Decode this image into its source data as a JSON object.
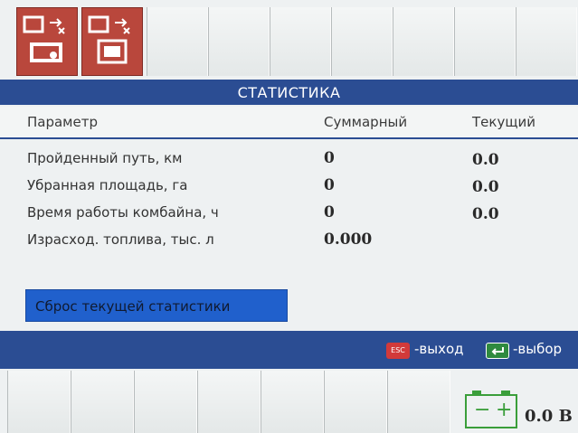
{
  "header": {
    "title": "СТАТИСТИКА"
  },
  "table": {
    "columns": [
      "Параметр",
      "Суммарный",
      "Текущий"
    ],
    "rows": [
      {
        "label": "Пройденный путь, км",
        "total": "0",
        "current": "0.0"
      },
      {
        "label": "Убранная площадь, га",
        "total": "0",
        "current": "0.0"
      },
      {
        "label": "Время работы комбайна, ч",
        "total": "0",
        "current": "0.0"
      },
      {
        "label": "Израсход. топлива, тыс. л",
        "total": "0.000",
        "current": ""
      }
    ]
  },
  "actions": {
    "reset_label": "Сброс текущей статистики"
  },
  "footer": {
    "esc_key": "ESC",
    "exit_hint": "-выход",
    "select_hint": "-выбор"
  },
  "status": {
    "voltage": "0.0 В"
  },
  "colors": {
    "header_blue": "#2b4d93",
    "button_blue": "#2060cc",
    "softkey_red": "#b9473c",
    "battery_green": "#3a9e3a"
  }
}
